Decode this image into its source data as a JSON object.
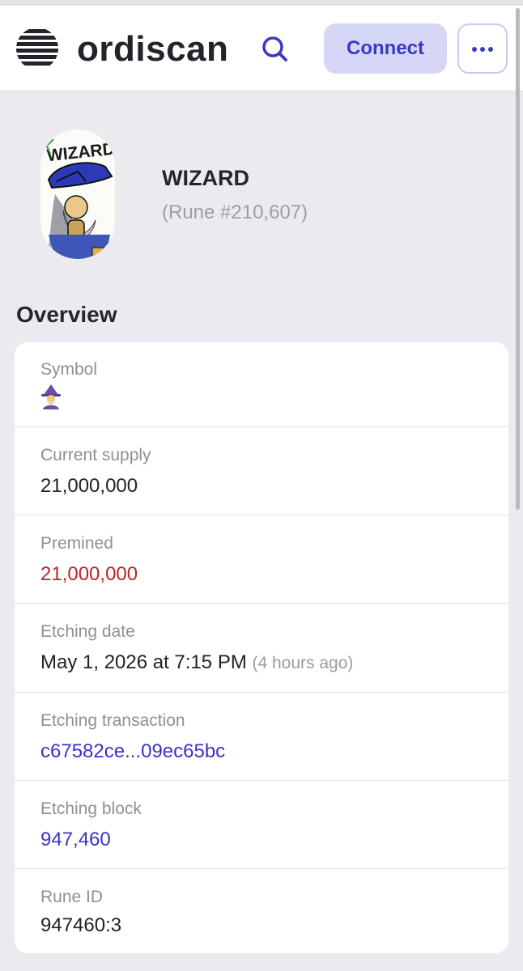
{
  "header": {
    "brand": "ordiscan",
    "connect_label": "Connect",
    "icons": {
      "logo": "ordiscan-logo",
      "search": "search-icon",
      "more": "more-horizontal-icon"
    },
    "colors": {
      "accent": "#3b39c2",
      "connect_bg": "#d6d7f6"
    }
  },
  "rune": {
    "name": "WIZARD",
    "number": "(Rune #210,607)",
    "image_text": "WIZARD"
  },
  "overview": {
    "title": "Overview",
    "symbol_label": "Symbol",
    "symbol_icon": "mage-emoji",
    "current_supply_label": "Current supply",
    "current_supply": "21,000,000",
    "premined_label": "Premined",
    "premined": "21,000,000",
    "etching_date_label": "Etching date",
    "etching_date": "May 1, 2026 at 7:15 PM",
    "etching_date_relative": "(4 hours ago)",
    "etching_tx_label": "Etching transaction",
    "etching_tx": "c67582ce...09ec65bc",
    "etching_block_label": "Etching block",
    "etching_block": "947,460",
    "rune_id_label": "Rune ID",
    "rune_id": "947460:3",
    "colors": {
      "premined": "#b8262b",
      "link": "#3a34c5"
    }
  }
}
